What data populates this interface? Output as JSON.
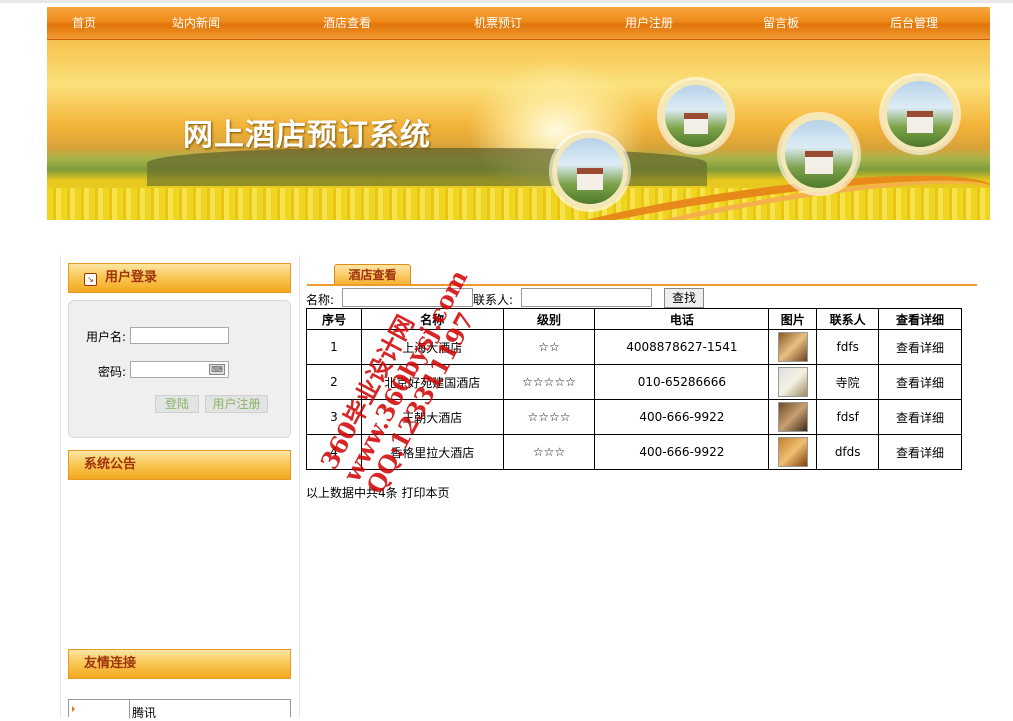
{
  "nav": [
    "首页",
    "站内新闻",
    "酒店查看",
    "机票预订",
    "用户注册",
    "留言板",
    "后台管理"
  ],
  "banner": {
    "title": "网上酒店预订系统"
  },
  "login": {
    "title": "用户登录",
    "username_label": "用户名:",
    "password_label": "密码:",
    "login_button": "登陆",
    "register_button": "用户注册"
  },
  "notice": {
    "title": "系统公告"
  },
  "friend_links": {
    "title": "友情连接",
    "items": [
      "腾讯"
    ]
  },
  "main": {
    "tab": "酒店查看",
    "search": {
      "name_label": "名称:",
      "contact_label": "联系人:",
      "button": "查找"
    },
    "table": {
      "headers": [
        "序号",
        "名称",
        "级别",
        "电话",
        "图片",
        "联系人",
        "查看详细"
      ],
      "rows": [
        {
          "no": "1",
          "name": "上海大酒店",
          "level": "☆☆",
          "phone": "4008878627-1541",
          "contact": "fdfs",
          "detail": "查看详细"
        },
        {
          "no": "2",
          "name": "北京好苑建国酒店",
          "level": "☆☆☆☆☆",
          "phone": "010-65286666",
          "contact": "寺院",
          "detail": "查看详细"
        },
        {
          "no": "3",
          "name": "王朝大酒店",
          "level": "☆☆☆☆",
          "phone": "400-666-9922",
          "contact": "fdsf",
          "detail": "查看详细"
        },
        {
          "no": "4",
          "name": "香格里拉大酒店",
          "level": "☆☆☆",
          "phone": "400-666-9922",
          "contact": "dfds",
          "detail": "查看详细"
        }
      ]
    },
    "footer": "以上数据中共4条  打印本页"
  },
  "watermark": [
    "360毕业设计网",
    "www.360bysj.com",
    "QQ:123311197"
  ],
  "colors": {
    "nav": "#ee8a1a",
    "accent": "#a0330a",
    "watermark": "#d20000"
  }
}
